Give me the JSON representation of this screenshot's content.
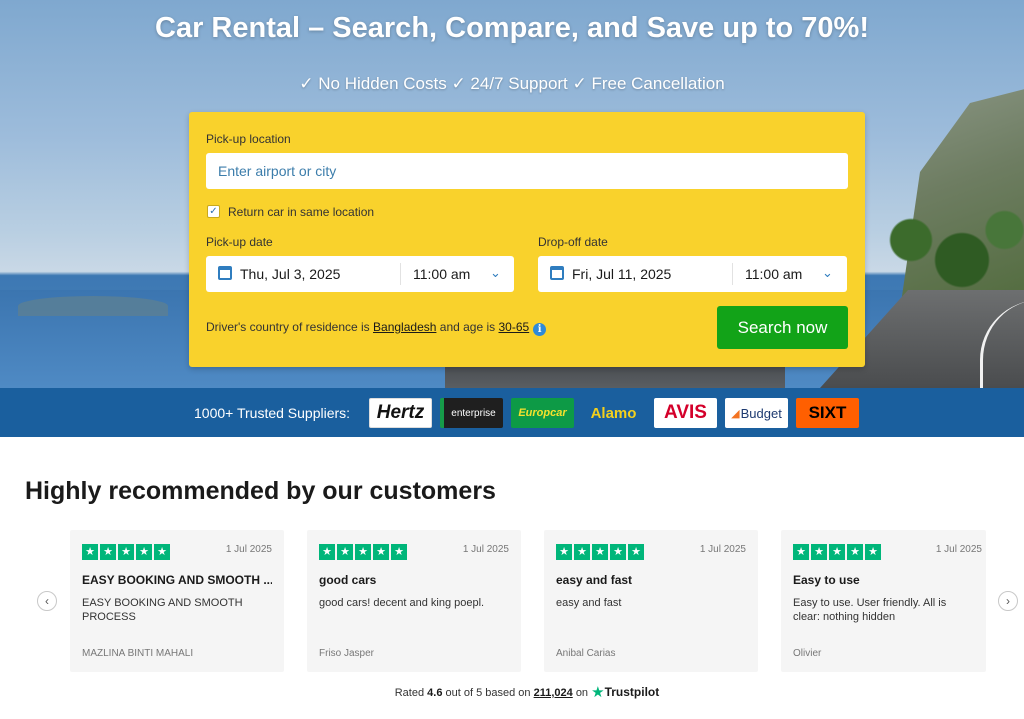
{
  "hero": {
    "title": "Car Rental – Search, Compare, and Save up to 70%!",
    "subtitle": "✓ No Hidden Costs ✓ 24/7 Support ✓ Free Cancellation"
  },
  "search": {
    "pickup_label": "Pick-up location",
    "pickup_placeholder": "Enter airport or city",
    "pickup_value": "",
    "return_same_label": "Return car in same location",
    "return_same_checked": true,
    "pickup_date_label": "Pick-up date",
    "pickup_date": "Thu, Jul 3, 2025",
    "pickup_time": "11:00 am",
    "dropoff_date_label": "Drop-off date",
    "dropoff_date": "Fri, Jul 11, 2025",
    "dropoff_time": "11:00 am",
    "residence_prefix": "Driver's country of residence is",
    "country": "Bangladesh",
    "age_prefix": "and age is",
    "age": "30-65",
    "button": "Search now"
  },
  "suppliers": {
    "label": "1000+ Trusted Suppliers:",
    "logos": [
      {
        "name": "Hertz",
        "bg": "#ffffff",
        "fg": "#111111",
        "accent": "#f7c600"
      },
      {
        "name": "enterprise",
        "bg": "#1f1f1f",
        "fg": "#ffffff",
        "accent": "#169b49"
      },
      {
        "name": "Europcar",
        "bg": "#0d9a46",
        "fg": "#f5e12d",
        "accent": "#0d9a46"
      },
      {
        "name": "Alamo",
        "bg": "#1a5f9e",
        "fg": "#f4d01c",
        "accent": "#1a5f9e"
      },
      {
        "name": "AVIS",
        "bg": "#ffffff",
        "fg": "#d4002a",
        "accent": "#d4002a"
      },
      {
        "name": "Budget",
        "bg": "#ffffff",
        "fg": "#1d3a70",
        "accent": "#f37321"
      },
      {
        "name": "SIXT",
        "bg": "#ff5f00",
        "fg": "#000000",
        "accent": "#ff5f00"
      }
    ]
  },
  "reviews": {
    "title": "Highly recommended by our customers",
    "prev_icon": "chevron-left-icon",
    "next_icon": "chevron-right-icon",
    "star_color": "#00b67a",
    "items": [
      {
        "date": "1 Jul 2025",
        "title": "EASY BOOKING AND SMOOTH ...",
        "body": "EASY BOOKING AND SMOOTH PROCESS",
        "author": "MAZLINA BINTI MAHALI"
      },
      {
        "date": "1 Jul 2025",
        "title": "good cars",
        "body": "good cars! decent and king poepl.",
        "author": "Friso Jasper"
      },
      {
        "date": "1 Jul 2025",
        "title": "easy and fast",
        "body": "easy and fast",
        "author": "Anibal Carias"
      },
      {
        "date": "1 Jul 2025",
        "title": "Easy to use",
        "body": "Easy to use. User friendly. All is clear: nothing hidden",
        "author": "Olivier"
      }
    ]
  },
  "rating": {
    "prefix": "Rated",
    "score": "4.6",
    "middle": "out of 5 based on",
    "count": "211,024",
    "on": "on",
    "brand": "Trustpilot"
  },
  "colors": {
    "search_box": "#f9d22c",
    "search_button": "#12a318",
    "supplier_bar": "#1a5f9e"
  }
}
